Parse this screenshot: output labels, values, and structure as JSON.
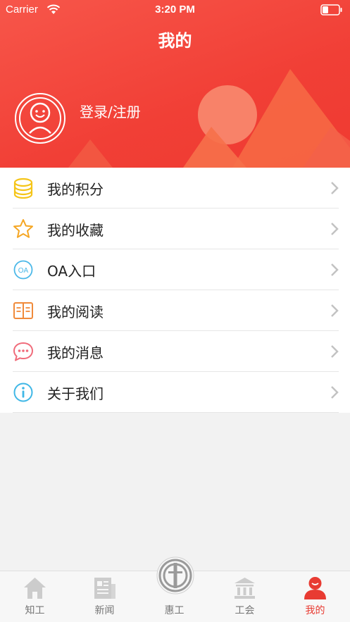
{
  "status_bar": {
    "carrier": "Carrier",
    "time": "3:20 PM"
  },
  "header": {
    "title": "我的",
    "login_text": "登录/注册"
  },
  "menu": [
    {
      "label": "我的积分",
      "icon": "coins-icon"
    },
    {
      "label": "我的收藏",
      "icon": "star-icon"
    },
    {
      "label": "OA入口",
      "icon": "oa-icon",
      "icon_text": "OA"
    },
    {
      "label": "我的阅读",
      "icon": "book-icon"
    },
    {
      "label": "我的消息",
      "icon": "chat-bubble-icon"
    },
    {
      "label": "关于我们",
      "icon": "info-icon"
    }
  ],
  "tabbar": [
    {
      "label": "知工",
      "icon": "home-icon",
      "active": false
    },
    {
      "label": "新闻",
      "icon": "newspaper-icon",
      "active": false
    },
    {
      "label": "惠工",
      "icon": "union-emblem-icon",
      "active": false
    },
    {
      "label": "工会",
      "icon": "institution-icon",
      "active": false
    },
    {
      "label": "我的",
      "icon": "user-icon",
      "active": true
    }
  ],
  "colors": {
    "primary": "#f13f36",
    "coins": "#f5c518",
    "star": "#f5a623",
    "oa": "#4bb8e8",
    "book": "#f08a3a",
    "chat": "#f06b7a",
    "info": "#3fb7e6",
    "inactive_tab": "#cccccc"
  }
}
